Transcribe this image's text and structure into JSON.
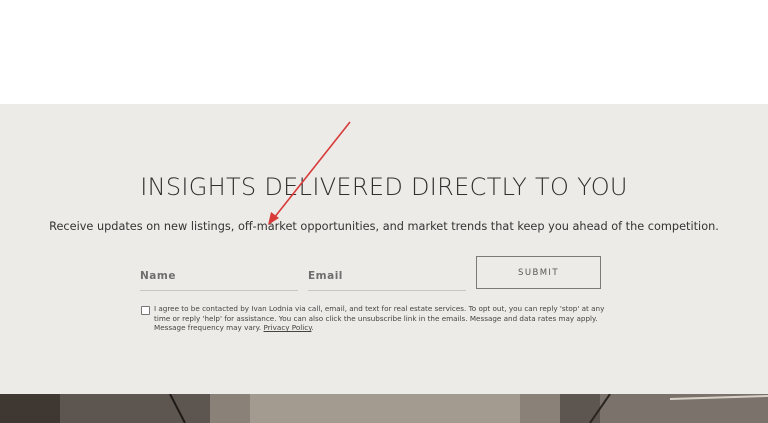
{
  "newsletter": {
    "title": "INSIGHTS DELIVERED DIRECTLY TO YOU",
    "subtitle": "Receive updates on new listings, off-market opportunities, and market trends that keep you ahead of the competition.",
    "name_placeholder": "Name",
    "email_placeholder": "Email",
    "submit_label": "SUBMIT",
    "consent_text": "I agree to be contacted by Ivan Lodnia via call, email, and text for real estate services. To opt out, you can reply 'stop' at any time or reply 'help' for assistance. You can also click the unsubscribe link in the emails. Message and data rates may apply. Message frequency may vary.",
    "privacy_link": "Privacy Policy",
    "consent_checked": false
  },
  "colors": {
    "section_bg": "#edebe7",
    "annotation_arrow": "#d83a3a"
  }
}
